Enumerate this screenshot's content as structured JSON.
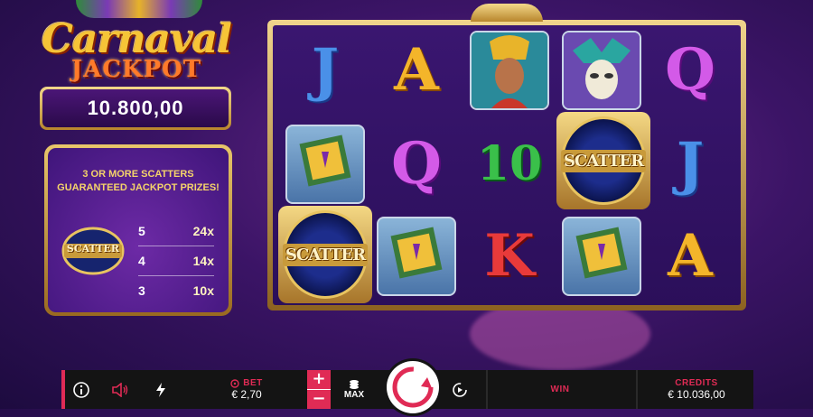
{
  "game": {
    "logo_title": "Carnaval",
    "logo_subtitle": "JACKPOT",
    "jackpot_value": "10.800,00"
  },
  "paytable": {
    "header_line1": "3 OR MORE SCATTERS",
    "header_line2": "GUARANTEED JACKPOT PRIZES!",
    "symbol_label": "SCATTER",
    "rows": [
      {
        "count": "5",
        "multiplier": "24x"
      },
      {
        "count": "4",
        "multiplier": "14x"
      },
      {
        "count": "3",
        "multiplier": "10x"
      }
    ]
  },
  "reels": {
    "scatter_label": "SCATTER",
    "ten_label": "10",
    "letters": {
      "J": "J",
      "A": "A",
      "Q": "Q",
      "K": "K"
    }
  },
  "controls": {
    "bet_label": "BET",
    "bet_value": "€ 2,70",
    "plus": "+",
    "minus": "−",
    "max_label": "MAX",
    "win_label": "WIN",
    "win_value": "",
    "credits_label": "CREDITS",
    "credits_value": "€ 10.036,00"
  },
  "colors": {
    "accent": "#e02b55",
    "gold": "#f3c437",
    "purple": "#3b1466"
  }
}
